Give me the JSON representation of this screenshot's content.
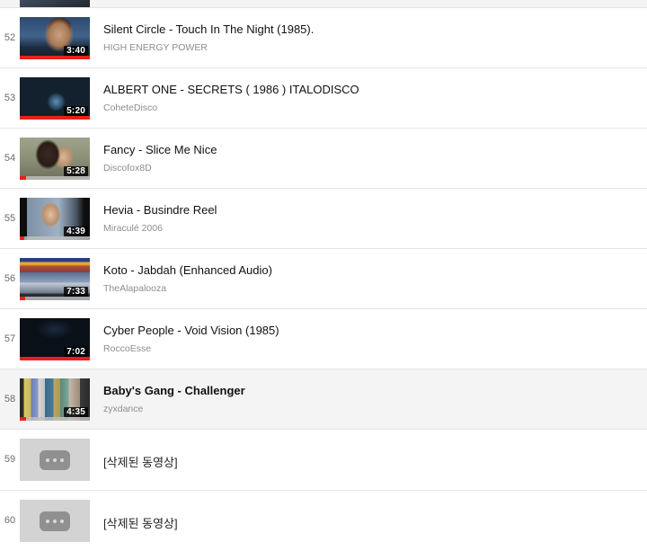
{
  "page": {
    "kind": "youtube-playlist-video-list",
    "accent_color": "#e62117",
    "selected_row_bg": "#f4f4f4"
  },
  "clipped_top_row": {
    "present": true
  },
  "items": [
    {
      "index": "52",
      "title": "Silent Circle - Touch In The Night (1985).",
      "channel": "HIGH ENERGY POWER",
      "duration": "3:40",
      "art": "art-silent",
      "watched_percent": 100,
      "selected": false,
      "deleted": false
    },
    {
      "index": "53",
      "title": "ALBERT ONE - SECRETS ( 1986 ) ITALODISCO",
      "channel": "CoheteDisco",
      "duration": "5:20",
      "art": "art-albert",
      "watched_percent": 100,
      "selected": false,
      "deleted": false
    },
    {
      "index": "54",
      "title": "Fancy - Slice Me Nice",
      "channel": "Discofox8D",
      "duration": "5:28",
      "art": "art-fancy",
      "watched_percent": 9,
      "selected": false,
      "deleted": false
    },
    {
      "index": "55",
      "title": "Hevia - Busindre Reel",
      "channel": "Miraculé 2006",
      "duration": "4:39",
      "art": "art-hevia",
      "watched_percent": 7,
      "selected": false,
      "deleted": false
    },
    {
      "index": "56",
      "title": "Koto - Jabdah (Enhanced Audio)",
      "channel": "TheAlapalooza",
      "duration": "7:33",
      "art": "art-koto",
      "watched_percent": 8,
      "selected": false,
      "deleted": false
    },
    {
      "index": "57",
      "title": "Cyber People - Void Vision (1985)",
      "channel": "RoccoEsse",
      "duration": "7:02",
      "art": "art-cyber",
      "watched_percent": 100,
      "selected": false,
      "deleted": false
    },
    {
      "index": "58",
      "title": "Baby's Gang - Challenger",
      "channel": "zyxdance",
      "duration": "4:35",
      "art": "art-babys",
      "watched_percent": 9,
      "selected": true,
      "deleted": false
    },
    {
      "index": "59",
      "title": "[삭제된 동영상]",
      "channel": "",
      "duration": "",
      "art": "",
      "watched_percent": 0,
      "selected": false,
      "deleted": true
    },
    {
      "index": "60",
      "title": "[삭제된 동영상]",
      "channel": "",
      "duration": "",
      "art": "",
      "watched_percent": 0,
      "selected": false,
      "deleted": true
    }
  ]
}
